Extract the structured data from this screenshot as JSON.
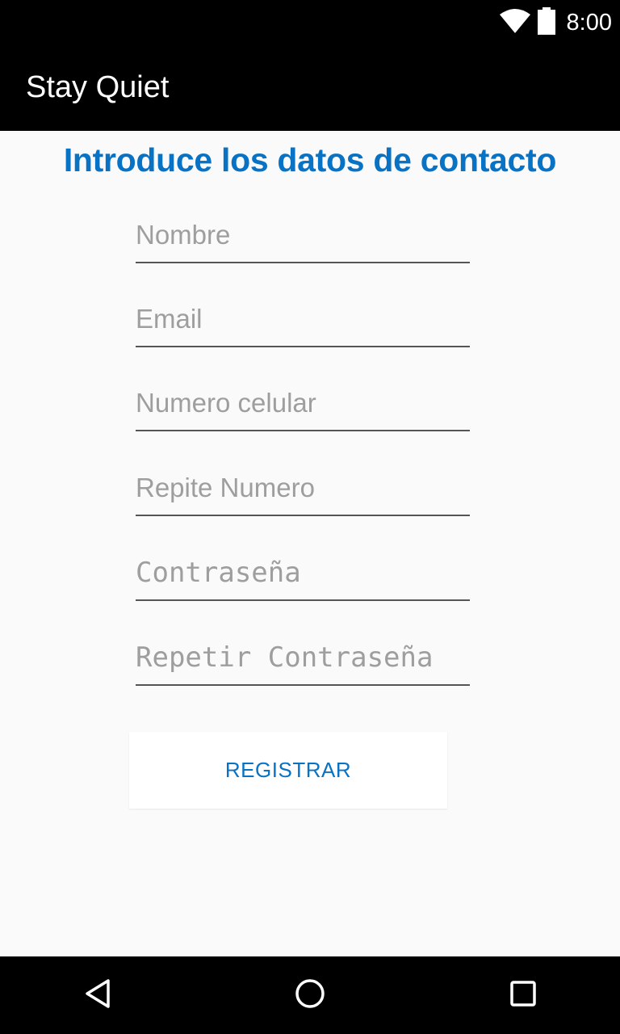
{
  "status_bar": {
    "time": "8:00",
    "icons": [
      "wifi-icon",
      "battery-icon"
    ]
  },
  "app_bar": {
    "title": "Stay Quiet"
  },
  "form": {
    "heading": "Introduce los datos de contacto",
    "fields": [
      {
        "placeholder": "Nombre",
        "value": ""
      },
      {
        "placeholder": "Email",
        "value": ""
      },
      {
        "placeholder": "Numero celular",
        "value": ""
      },
      {
        "placeholder": "Repite Numero",
        "value": ""
      },
      {
        "placeholder": "Contraseña",
        "value": ""
      },
      {
        "placeholder": "Repetir Contraseña",
        "value": ""
      }
    ],
    "submit_label": "REGISTRAR"
  },
  "nav_bar": {
    "buttons": [
      "back-icon",
      "home-icon",
      "recents-icon"
    ]
  },
  "colors": {
    "accent": "#0872c4",
    "bar_background": "#000000",
    "page_background": "#fafafa",
    "placeholder": "#9e9e9e"
  }
}
